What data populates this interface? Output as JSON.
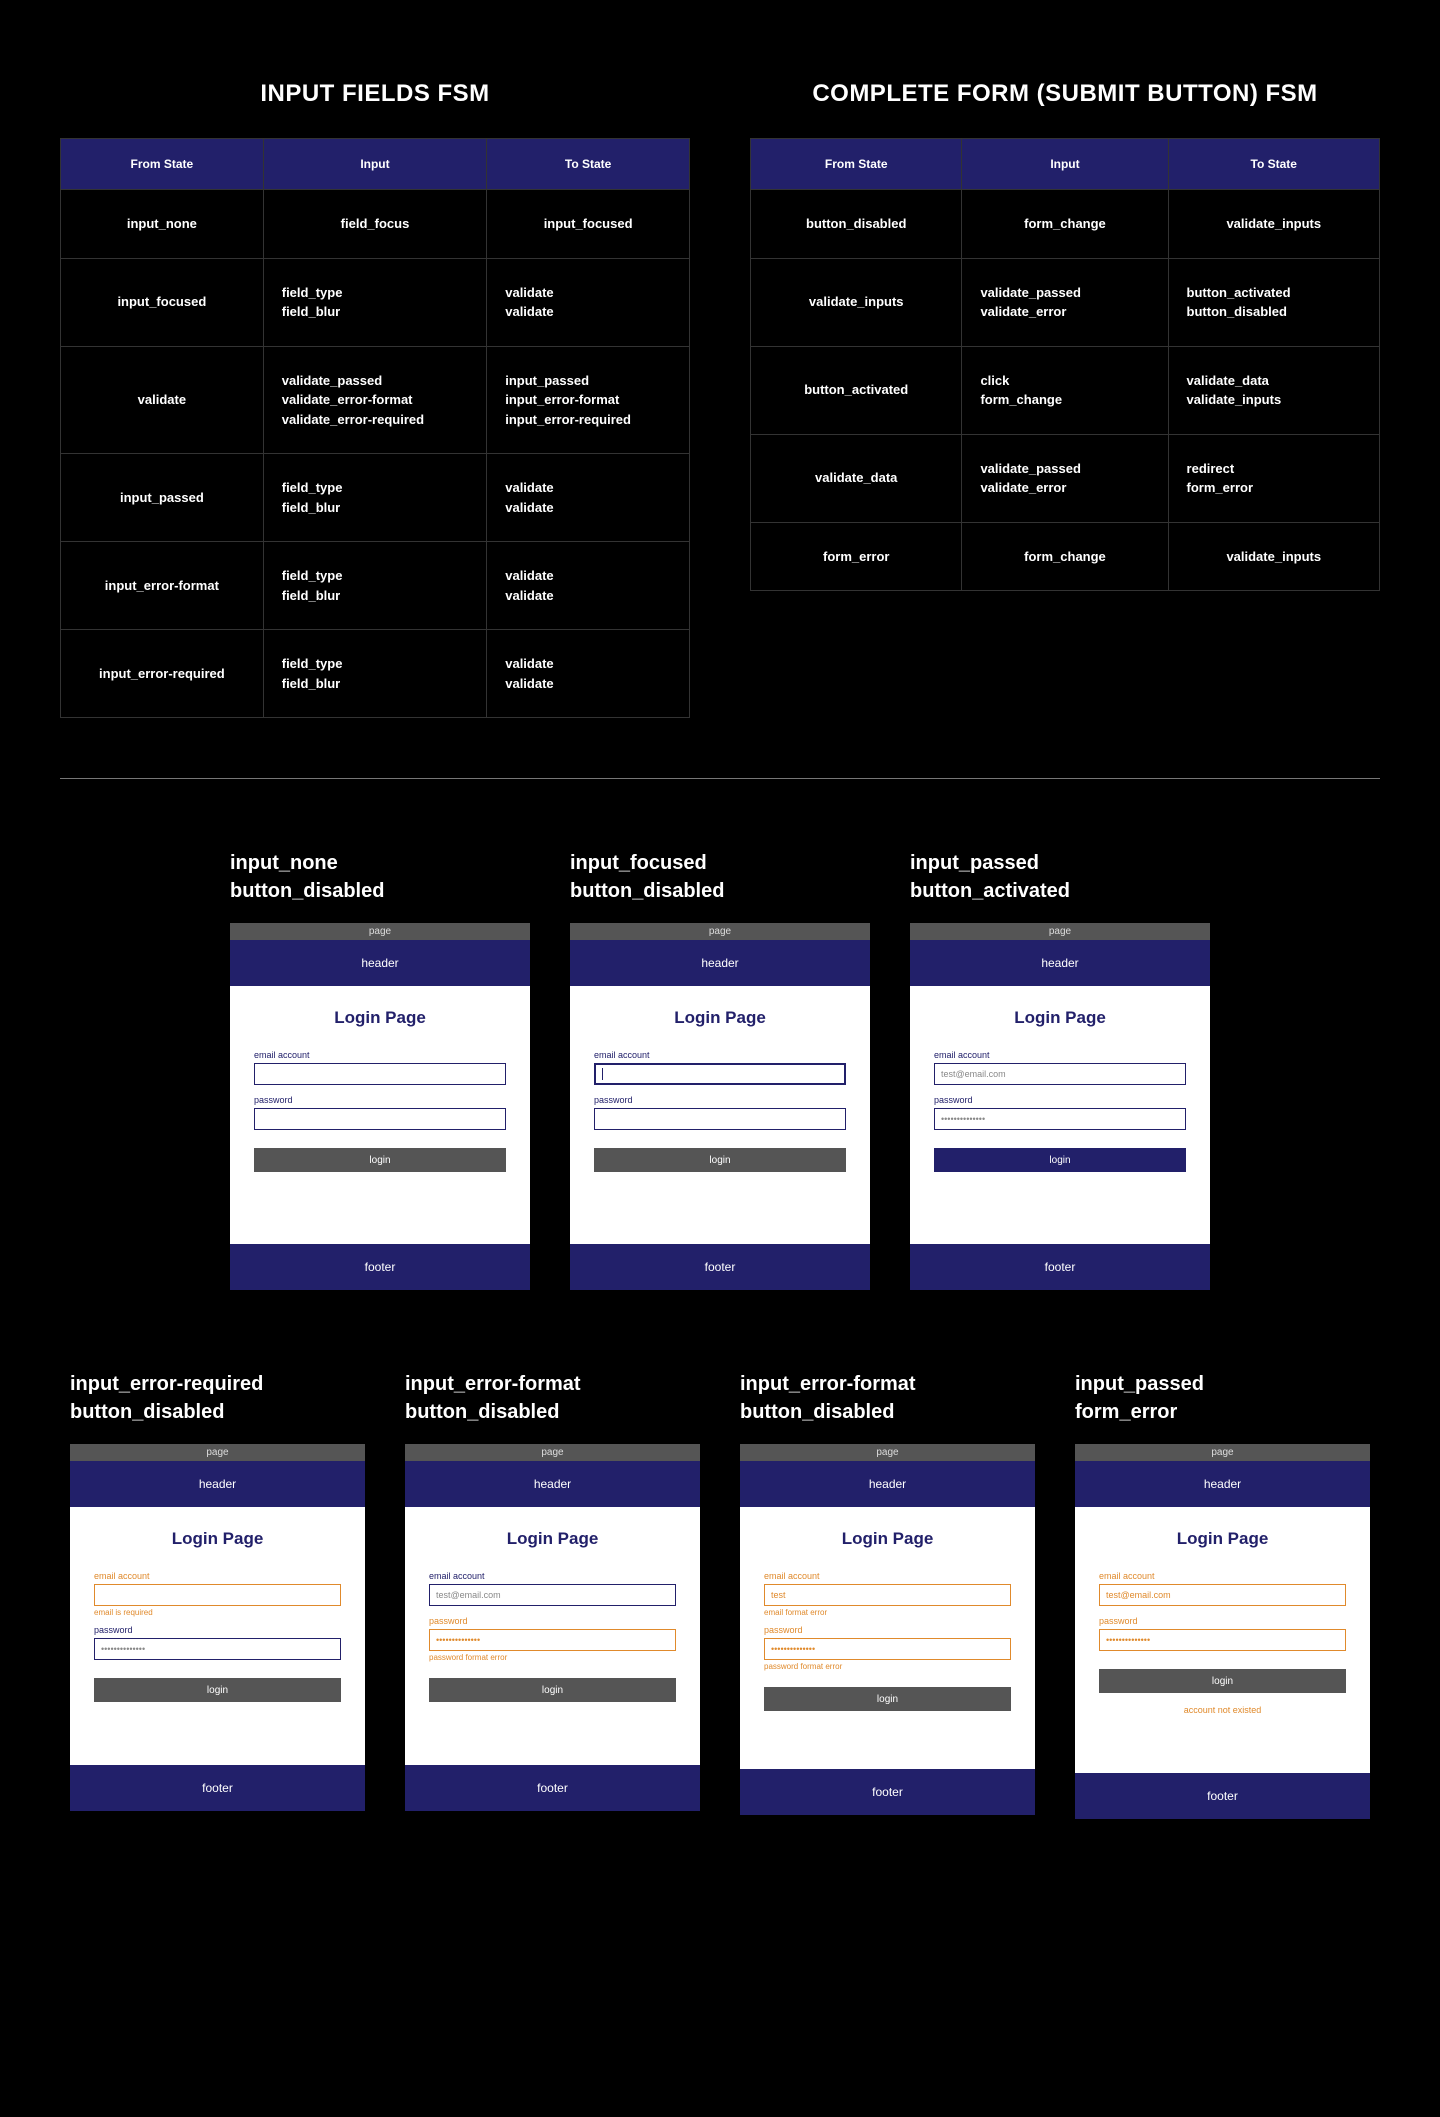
{
  "tables": {
    "input_fields": {
      "title": "INPUT FIELDS FSM",
      "headers": [
        "From State",
        "Input",
        "To State"
      ],
      "rows": [
        {
          "from": "input_none",
          "input": "field_focus",
          "to": "input_focused"
        },
        {
          "from": "input_focused",
          "input": "field_type\nfield_blur",
          "to": "validate\nvalidate"
        },
        {
          "from": "validate",
          "input": "validate_passed\nvalidate_error-format\nvalidate_error-required",
          "to": "input_passed\ninput_error-format\ninput_error-required"
        },
        {
          "from": "input_passed",
          "input": "field_type\nfield_blur",
          "to": "validate\nvalidate"
        },
        {
          "from": "input_error-format",
          "input": "field_type\nfield_blur",
          "to": "validate\nvalidate"
        },
        {
          "from": "input_error-required",
          "input": "field_type\nfield_blur",
          "to": "validate\nvalidate"
        }
      ]
    },
    "submit_button": {
      "title": "COMPLETE FORM (SUBMIT BUTTON) FSM",
      "headers": [
        "From State",
        "Input",
        "To State"
      ],
      "rows": [
        {
          "from": "button_disabled",
          "input": "form_change",
          "to": "validate_inputs"
        },
        {
          "from": "validate_inputs",
          "input": "validate_passed\nvalidate_error",
          "to": "button_activated\nbutton_disabled"
        },
        {
          "from": "button_activated",
          "input": "click\nform_change",
          "to": "validate_data\nvalidate_inputs"
        },
        {
          "from": "validate_data",
          "input": "validate_passed\nvalidate_error",
          "to": "redirect\nform_error"
        },
        {
          "from": "form_error",
          "input": "form_change",
          "to": "validate_inputs"
        }
      ]
    }
  },
  "mock_common": {
    "page_label": "page",
    "header_label": "header",
    "footer_label": "footer",
    "form_title": "Login Page",
    "email_label": "email account",
    "password_label": "password",
    "login_label": "login"
  },
  "mocks_row1": [
    {
      "state_line1": "input_none",
      "state_line2": "button_disabled",
      "email_focused": false,
      "email_error": false,
      "email_value": "",
      "password_error": false,
      "password_value": "",
      "button_active": false
    },
    {
      "state_line1": "input_focused",
      "state_line2": "button_disabled",
      "email_focused": true,
      "email_error": false,
      "email_value": "",
      "password_error": false,
      "password_value": "",
      "button_active": false
    },
    {
      "state_line1": "input_passed",
      "state_line2": "button_activated",
      "email_focused": false,
      "email_error": false,
      "email_value": "test@email.com",
      "password_error": false,
      "password_value": "••••••••••••••",
      "button_active": true
    }
  ],
  "mocks_row2": [
    {
      "state_line1": "input_error-required",
      "state_line2": "button_disabled",
      "email_label_error": true,
      "email_error": true,
      "email_value": "",
      "email_err_msg": "email is required",
      "password_label_error": false,
      "password_error": false,
      "password_value": "••••••••••••••",
      "button_active": false
    },
    {
      "state_line1": "input_error-format",
      "state_line2": "button_disabled",
      "email_label_error": false,
      "email_error": false,
      "email_value": "test@email.com",
      "password_label_error": true,
      "password_error": true,
      "password_value": "••••••••••••••",
      "password_err_msg": "password format error",
      "button_active": false
    },
    {
      "state_line1": "input_error-format",
      "state_line2": "button_disabled",
      "email_label_error": true,
      "email_error": true,
      "email_value": "test",
      "email_err_msg": "email format error",
      "password_label_error": true,
      "password_error": true,
      "password_value": "••••••••••••••",
      "password_err_msg": "password format error",
      "button_active": false
    },
    {
      "state_line1": "input_passed",
      "state_line2": "form_error",
      "email_label_error": true,
      "email_error": true,
      "email_value": "test@email.com",
      "password_label_error": true,
      "password_error": true,
      "password_value": "••••••••••••••",
      "button_active": false,
      "button_dark_gray": true,
      "form_error_msg": "account not existed"
    }
  ]
}
